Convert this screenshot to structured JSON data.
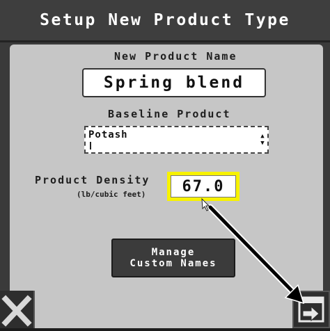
{
  "header": {
    "title": "Setup New Product Type"
  },
  "product_name": {
    "label": "New Product Name",
    "value": "Spring blend"
  },
  "baseline": {
    "label": "Baseline Product",
    "selected": "Potash"
  },
  "density": {
    "label": "Product Density",
    "unit": "(lb/cubic feet)",
    "value": "67.0"
  },
  "buttons": {
    "manage_line1": "Manage",
    "manage_line2": "Custom Names"
  },
  "icons": {
    "cancel": "close-x-icon",
    "next": "next-page-icon",
    "scroll": "up-down-arrows-icon"
  },
  "colors": {
    "highlight": "#f7f200",
    "header_bg": "#3e3e3e",
    "panel_bg": "#c6c6c6",
    "annotation_arrow": "#000000"
  }
}
